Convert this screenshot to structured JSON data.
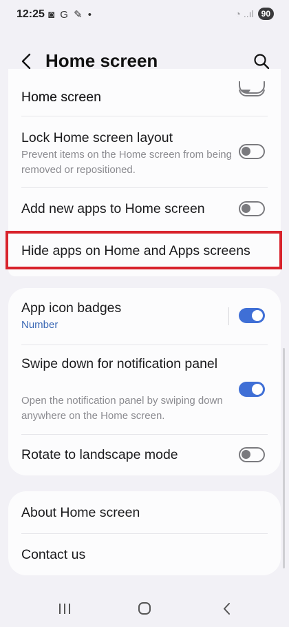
{
  "status_bar": {
    "time": "12:25",
    "left_icons": "◙ G ✎ •",
    "signal_glyph": "◔ ..ıl",
    "battery": "90"
  },
  "app_bar": {
    "title": "Home screen",
    "back_icon": "chevron-left-icon",
    "search_icon": "search-icon"
  },
  "card1": {
    "items": [
      {
        "title": "Home screen",
        "toggle": "off"
      },
      {
        "title": "Lock Home screen layout",
        "subtitle": "Prevent items on the Home screen from being removed or repositioned.",
        "toggle": "off"
      },
      {
        "title": "Add new apps to Home screen",
        "toggle": "off"
      }
    ],
    "hide_apps": "Hide apps on Home and Apps screens"
  },
  "card2": {
    "items": [
      {
        "title": "App icon badges",
        "subtitle": "Number",
        "toggle": "on"
      },
      {
        "title": "Swipe down for notification panel",
        "subtitle": "Open the notification panel by swiping down anywhere on the Home screen.",
        "toggle": "on"
      },
      {
        "title": "Rotate to landscape mode",
        "toggle": "off"
      }
    ]
  },
  "card3": {
    "items": [
      {
        "title": "About Home screen"
      },
      {
        "title": "Contact us"
      }
    ]
  },
  "nav_bar": {
    "recents_icon": "recents-icon",
    "home_icon": "home-icon",
    "back_icon": "back-icon"
  },
  "colors": {
    "accent": "#3f6fd6",
    "highlight": "#d8222b",
    "background": "#f2f1f6"
  }
}
